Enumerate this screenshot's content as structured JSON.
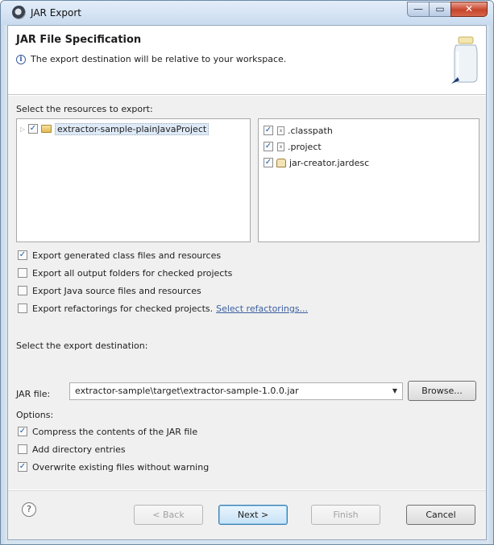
{
  "window": {
    "title": "JAR Export",
    "min_glyph": "—",
    "max_glyph": "▭",
    "close_glyph": "✕"
  },
  "header": {
    "title": "JAR File Specification",
    "message": "The export destination will be relative to your workspace.",
    "info_glyph": "i"
  },
  "resources": {
    "label": "Select the resources to export:",
    "tree_item": "extractor-sample-plainJavaProject",
    "files": [
      ".classpath",
      ".project",
      "jar-creator.jardesc"
    ]
  },
  "export_options": {
    "generated_class_files": "Export generated class files and resources",
    "output_folders": "Export all output folders for checked projects",
    "java_source": "Export Java source files and resources",
    "refactorings": "Export refactorings for checked projects.",
    "select_refactorings": "Select refactorings..."
  },
  "destination": {
    "label": "Select the export destination:",
    "jar_file_label": "JAR file:",
    "jar_file_value": "extractor-sample\\target\\extractor-sample-1.0.0.jar",
    "browse_label": "Browse..."
  },
  "options": {
    "label": "Options:",
    "compress": "Compress the contents of the JAR file",
    "directory_entries": "Add directory entries",
    "overwrite": "Overwrite existing files without warning"
  },
  "checks": {
    "tree_item": true,
    "files": [
      true,
      true,
      true
    ],
    "generated_class_files": true,
    "output_folders": false,
    "java_source": false,
    "refactorings": false,
    "compress": true,
    "directory_entries": false,
    "overwrite": true
  },
  "footer": {
    "help_glyph": "?",
    "back_label": "< Back",
    "next_label": "Next >",
    "finish_label": "Finish",
    "cancel_label": "Cancel"
  }
}
